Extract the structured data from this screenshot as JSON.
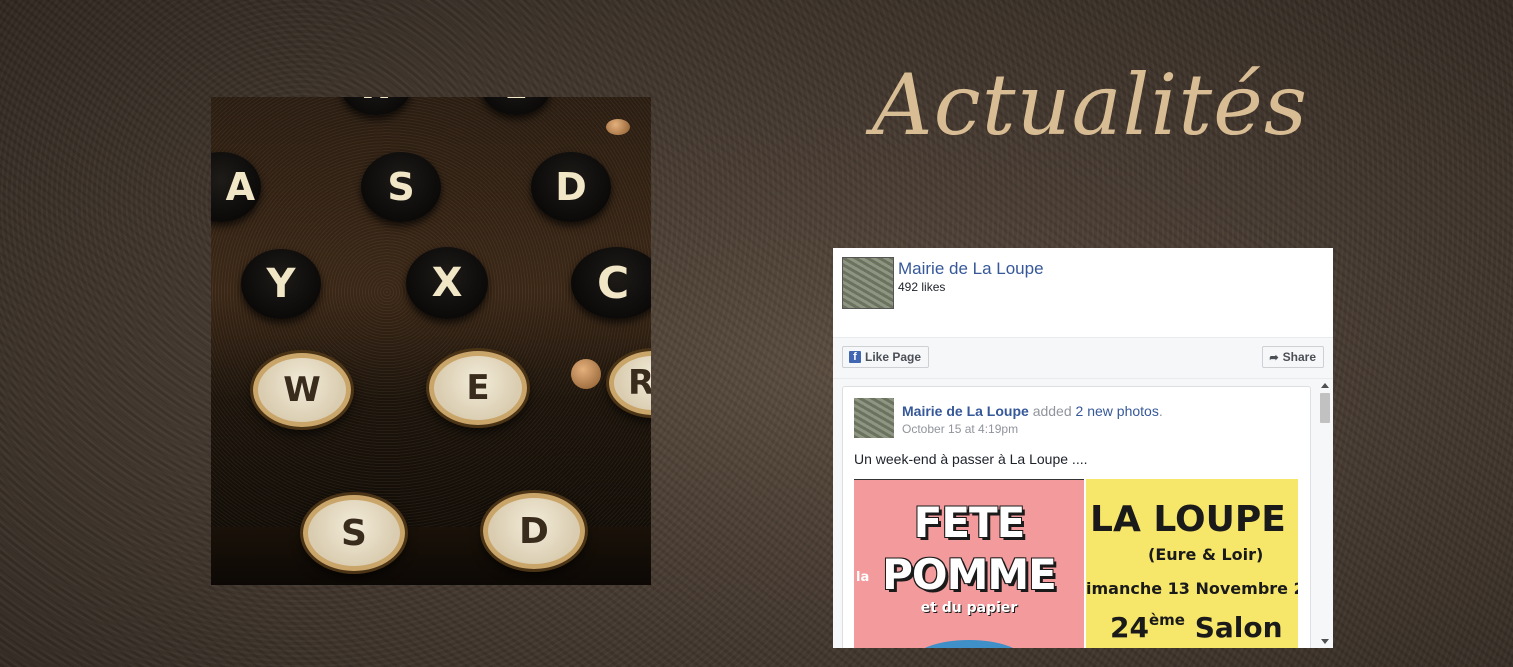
{
  "heading": "Actualités",
  "typewriter": {
    "keys": [
      "W",
      "E",
      "A",
      "S",
      "D",
      "Y",
      "X",
      "C",
      "W",
      "E",
      "R",
      "S",
      "D"
    ]
  },
  "facebook": {
    "page_name": "Mairie de La Loupe",
    "likes": "492 likes",
    "like_button": "Like Page",
    "share_button": "Share",
    "post": {
      "author": "Mairie de La Loupe",
      "action_text": "added",
      "action_link": "2 new photos",
      "period": ".",
      "timestamp": "October 15 at 4:19pm",
      "text": "Un week-end à passer à La Loupe ....",
      "photo1": {
        "line1": "FETE",
        "line2": "la",
        "line3": "POMME",
        "line4": "et du papier"
      },
      "photo2": {
        "line1": "LA LOUPE",
        "line2": "(Eure & Loir)",
        "line3": "imanche 13 Novembre 2",
        "line4_num": "24",
        "line4_sup": "ème",
        "line4_word": "Salon"
      }
    }
  }
}
